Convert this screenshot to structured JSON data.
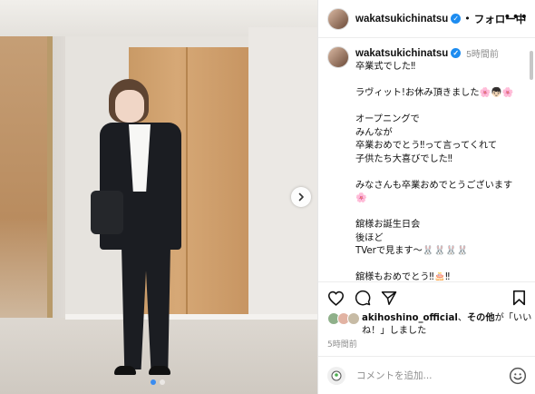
{
  "post": {
    "username": "wakatsukichinatsu",
    "follow_label": "フォロー中",
    "separator": "•",
    "time_ago_short": "5時間前",
    "caption": "卒業式でした‼\n\nラヴィット!お休み頂きました🌸👦🏻🌸\n\nオープニングで\nみんなが\n卒業おめでとう‼って言ってくれて\n子供たち大喜びでした‼\n\nみなさんも卒業おめでとうございます\n🌸\n\n舘様お誕生日会\n後ほど\nTVerで見ます〜🐰🐰🐰🐰\n\n舘様もおめでとう‼🎂‼",
    "liked_by_user": "akihoshino_official",
    "liked_by_sep": "、",
    "liked_by_others": "その他",
    "liked_by_suffix": "が「いいね！」しました",
    "time_ago_long": "5時間前"
  },
  "comment": {
    "placeholder": "コメントを追加..."
  },
  "icons": {
    "more": "more-options-icon",
    "verified": "verified-badge-icon",
    "like": "heart-icon",
    "comment": "comment-bubble-icon",
    "share": "paper-plane-icon",
    "save": "bookmark-icon",
    "emoji": "emoji-icon",
    "next": "chevron-right-icon"
  },
  "colors": {
    "verified_blue": "#1d8cf0",
    "muted_text": "#8e8e8e",
    "active_dot": "#3a8cf0"
  },
  "carousel": {
    "slide_count": 2,
    "active_slide": 1
  }
}
